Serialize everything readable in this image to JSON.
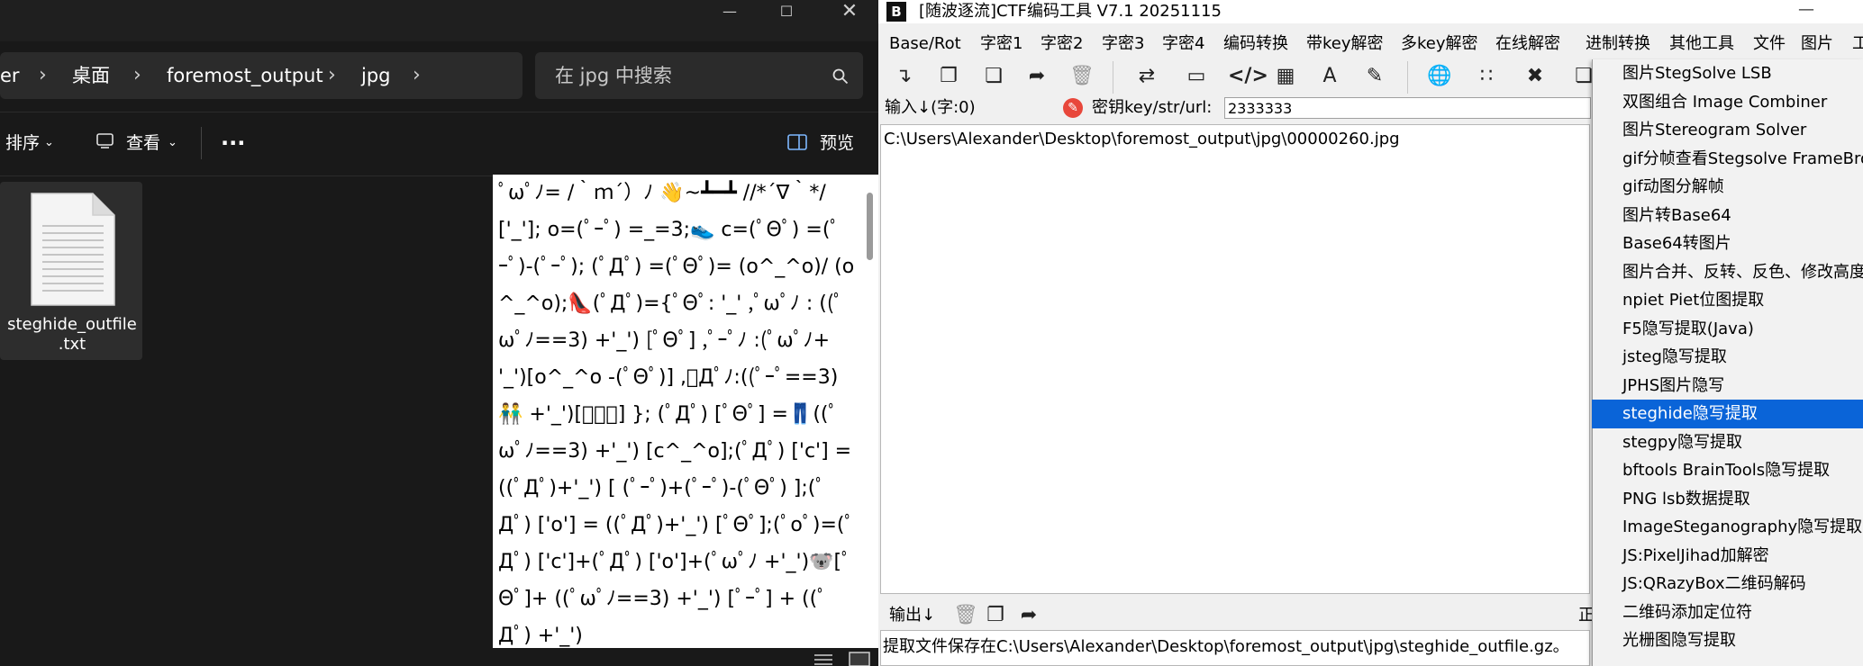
{
  "explorer": {
    "breadcrumb": [
      "er",
      "桌面",
      "foremost_output",
      "jpg"
    ],
    "search_placeholder": "在 jpg 中搜索",
    "toolbar": {
      "sort": "排序",
      "view": "查看",
      "more": "···",
      "preview": "预览"
    },
    "file": {
      "name": "steghide_outfile\n.txt"
    },
    "preview_text": "ﾟωﾟﾉ= /｀ｍ´）ﾉ 👋~┻━┻ //*´∇｀*/ ['_']; o=(ﾟｰﾟ) =_=3;👟 c=(ﾟΘﾟ) =(ﾟｰﾟ)-(ﾟｰﾟ); (ﾟДﾟ) =(ﾟΘﾟ)= (o^_^o)/ (o^_^o);👠(ﾟДﾟ)={ﾟΘﾟ: '_' ,ﾟωﾟﾉ : ((ﾟωﾟﾉ==3) +'_') [ﾟΘﾟ] ,ﾟｰﾟﾉ :(ﾟωﾟﾉ+ '_')[o^_^o -(ﾟΘﾟ)] ,ﾟДﾟﾉ:((ﾟｰﾟ==3)👬 +'_')[ﾟｰﾟ] }; (ﾟДﾟ) [ﾟΘﾟ] =👖((ﾟωﾟﾉ==3) +'_') [c^_^o];(ﾟДﾟ) ['c'] = ((ﾟДﾟ)+'_') [ (ﾟｰﾟ)+(ﾟｰﾟ)-(ﾟΘﾟ) ];(ﾟДﾟ) ['o'] = ((ﾟДﾟ)+'_') [ﾟΘﾟ];(ﾟoﾟ)=(ﾟДﾟ) ['c']+(ﾟДﾟ) ['o']+(ﾟωﾟﾉ +'_')🐨[ﾟΘﾟ]+ ((ﾟωﾟﾉ==3) +'_') [ﾟｰﾟ] + ((ﾟДﾟ) +'_')"
  },
  "ctf": {
    "title": "[随波逐流]CTF编码工具 V7.1  20251115",
    "menu": [
      "Base/Rot",
      "字密1",
      "字密2",
      "字密3",
      "字密4",
      "编码转换",
      "带key解密",
      "多key解密",
      "在线解密",
      "进制转换",
      "其他工具",
      "文件",
      "图片",
      "工"
    ],
    "input_label": "输入↓(字:0)",
    "key_label": "密钥key/str/url:",
    "key_value": "2333333",
    "main_text": "C:\\Users\\Alexander\\Desktop\\foremost_output\\jpg\\00000260.jpg",
    "output_label": "输出↓",
    "output_text": "提取文件保存在C:\\Users\\Alexander\\Desktop\\foremost_output\\jpg\\steghide_outfile.gz。",
    "side_stub": "正"
  },
  "dropdown": {
    "items": [
      "图片StegSolve LSB",
      "双图组合 Image Combiner",
      "图片Stereogram Solver",
      "gif分帧查看Stegsolve FrameBrowser",
      "gif动图分解帧",
      "图片转Base64",
      "Base64转图片",
      "图片合并、反转、反色、修改高度",
      "npiet Piet位图提取",
      "F5隐写提取(Java)",
      "jsteg隐写提取",
      "JPHS图片隐写",
      "steghide隐写提取",
      "stegpy隐写提取",
      "bftools BrainTools隐写提取",
      "PNG lsb数据提取",
      "ImageSteganography隐写提取",
      "JS:PixelJihad加解密",
      "JS:QRazyBox二维码解码",
      "二维码添加定位符",
      "光栅图隐写提取"
    ],
    "selected_index": 12
  }
}
